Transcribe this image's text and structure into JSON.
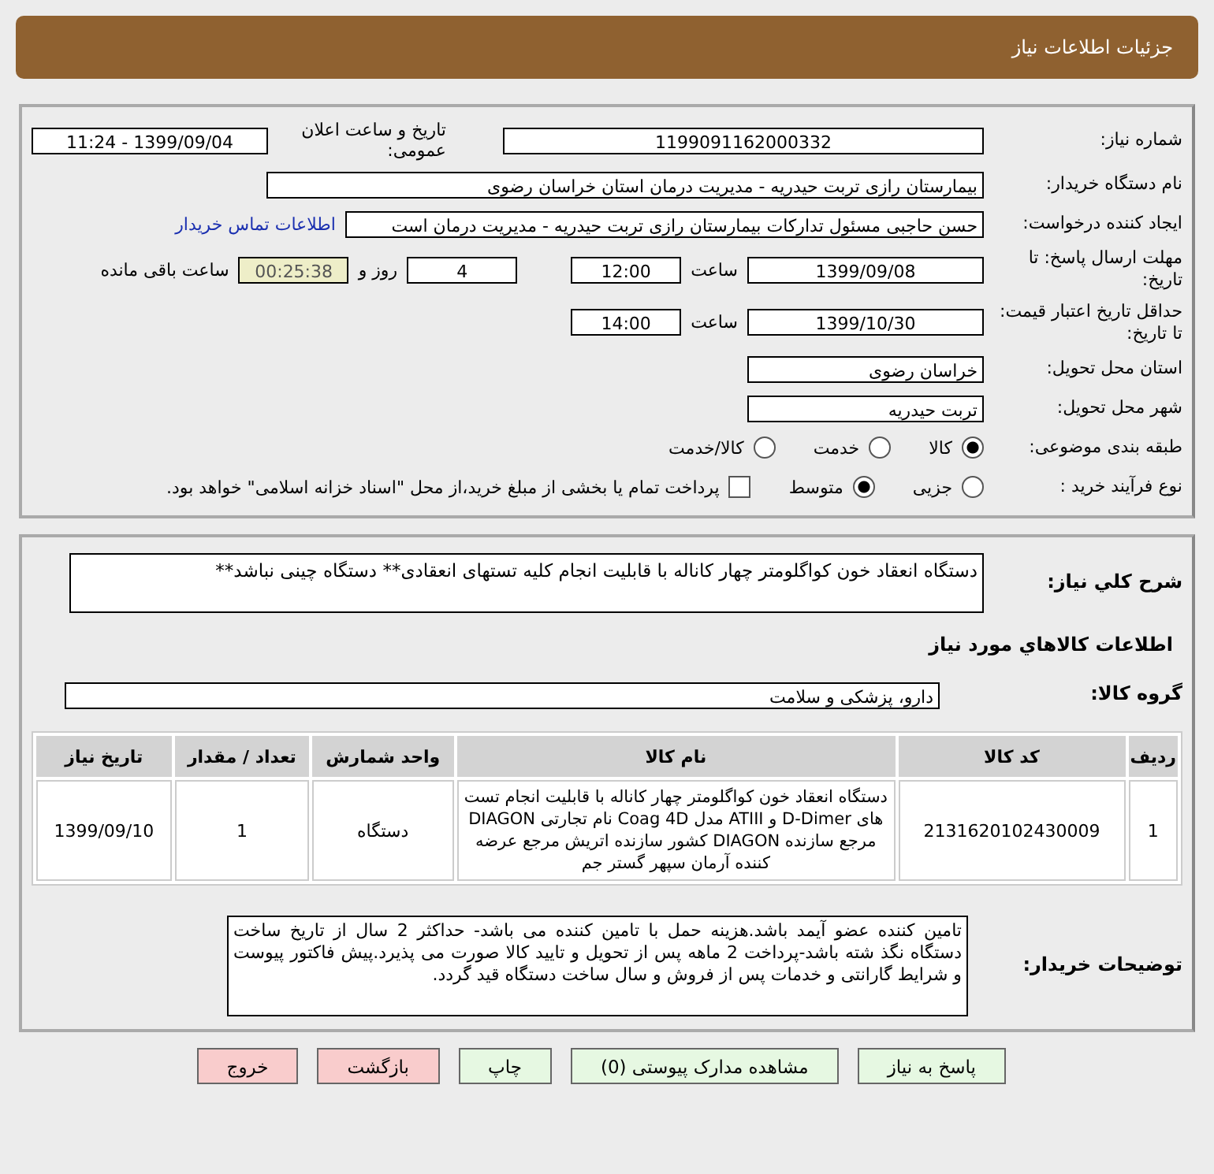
{
  "header": {
    "title": "جزئیات اطلاعات نیاز"
  },
  "info": {
    "need_number_label": "شماره نیاز:",
    "need_number": "1199091162000332",
    "announce_label": "تاریخ و ساعت اعلان عمومی:",
    "announce_value": "1399/09/04 - 11:24",
    "buyer_label": "نام دستگاه خریدار:",
    "buyer": "بیمارستان رازی تربت حیدریه - مدیریت درمان استان خراسان رضوی",
    "creator_label": "ایجاد کننده درخواست:",
    "creator": "حسن حاجبی مسئول تدارکات بیمارستان رازی تربت حیدریه - مدیریت درمان است",
    "contact_link": "اطلاعات تماس خریدار",
    "deadline_label": "مهلت ارسال پاسخ: تا تاریخ:",
    "deadline_date": "1399/09/08",
    "time_label": "ساعت",
    "deadline_time": "12:00",
    "days": "4",
    "days_label": "روز و",
    "remaining": "00:25:38",
    "remaining_label": "ساعت باقی مانده",
    "validity_label": "حداقل تاریخ اعتبار قیمت: تا تاریخ:",
    "validity_date": "1399/10/30",
    "validity_time_label": "ساعت",
    "validity_time": "14:00",
    "province_label": "استان محل تحویل:",
    "province": "خراسان رضوی",
    "city_label": "شهر محل تحویل:",
    "city": "تربت حیدریه"
  },
  "category": {
    "label": "طبقه بندی موضوعی:",
    "options": [
      {
        "label": "کالا",
        "selected": true
      },
      {
        "label": "خدمت",
        "selected": false
      },
      {
        "label": "کالا/خدمت",
        "selected": false
      }
    ]
  },
  "process": {
    "label": "نوع فرآیند خرید :",
    "options": [
      {
        "label": "جزیی",
        "selected": false
      },
      {
        "label": "متوسط",
        "selected": true
      }
    ],
    "treasury": {
      "label": "پرداخت تمام یا بخشی از مبلغ خرید،از محل \"اسناد خزانه اسلامی\" خواهد بود.",
      "checked": false
    }
  },
  "description": {
    "label": "شرح کلي نياز:",
    "text": "دستگاه انعقاد خون کواگلومتر چهار کاناله با قابلیت انجام کلیه تستهای انعقادی** دستگاه چینی نباشد**"
  },
  "goods_title": "اطلاعات کالاهاي مورد نياز",
  "group": {
    "label": "گروه کالا:",
    "value": "دارو، پزشکی و سلامت"
  },
  "table": {
    "columns": [
      "ردیف",
      "کد کالا",
      "نام کالا",
      "واحد شمارش",
      "تعداد / مقدار",
      "تاریخ نیاز"
    ],
    "rows": [
      [
        "1",
        "2131620102430009",
        "دستگاه انعقاد خون کواگلومتر چهار کاناله با قابلیت انجام تست های D-Dimer و ATIII مدل Coag 4D نام تجارتی DIAGON مرجع سازنده DIAGON کشور سازنده اتریش مرجع عرضه کننده آرمان سپهر گستر جم",
        "دستگاه",
        "1",
        "1399/09/10"
      ]
    ]
  },
  "notes": {
    "label": "توضیحات خریدار:",
    "text": "تامین کننده عضو آیمد باشد.هزینه حمل با تامین کننده می باشد- حداکثر 2 سال از تاریخ ساخت دستگاه نگذ شته باشد-پرداخت 2 ماهه پس از تحویل و تایید کالا صورت می پذیرد.پیش فاکتور پیوست و شرایط گارانتی و خدمات پس از فروش  و سال ساخت دستگاه قید گردد."
  },
  "buttons": [
    {
      "label": "پاسخ به نیاز",
      "kind": "normal"
    },
    {
      "label": "مشاهده مدارک پیوستی (0)",
      "kind": "normal"
    },
    {
      "label": "چاپ",
      "kind": "normal"
    },
    {
      "label": "بازگشت",
      "kind": "danger"
    },
    {
      "label": "خروج",
      "kind": "danger"
    }
  ]
}
